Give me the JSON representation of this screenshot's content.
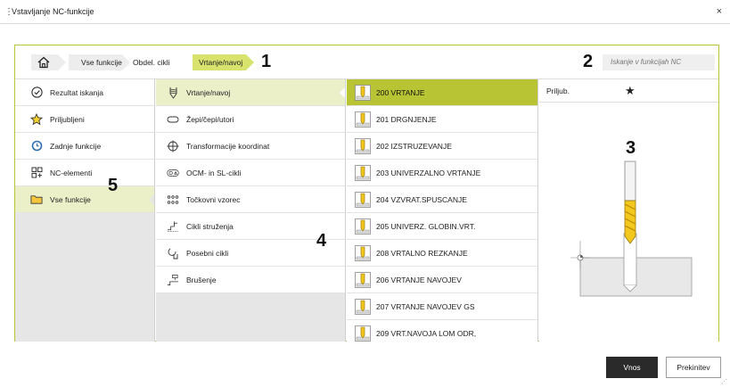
{
  "window": {
    "title": "Vstavljanje NC-funkcije",
    "close_icon": "×",
    "menu_icon": "⋮"
  },
  "breadcrumb": {
    "items": [
      "Vse funkcije",
      "Obdel. cikli",
      "Vrtanje/navoj"
    ],
    "active_index": 2
  },
  "search": {
    "placeholder": "Iskanje v funkcijah NC",
    "value": ""
  },
  "callouts": [
    "1",
    "2",
    "3",
    "4",
    "5"
  ],
  "column1": {
    "items": [
      {
        "label": "Rezultat iskanja",
        "icon": "check-circle-icon"
      },
      {
        "label": "Priljubljeni",
        "icon": "star-outline-icon"
      },
      {
        "label": "Zadnje funkcije",
        "icon": "clock-icon"
      },
      {
        "label": "NC-elementi",
        "icon": "nc-elements-icon"
      },
      {
        "label": "Vse funkcije",
        "icon": "folder-icon"
      }
    ],
    "selected_index": 4
  },
  "column2": {
    "items": [
      {
        "label": "Vrtanje/navoj",
        "icon": "drill-thread-icon"
      },
      {
        "label": "Žepi/čepi/utori",
        "icon": "pocket-slot-icon"
      },
      {
        "label": "Transformacije koordinat",
        "icon": "coordinate-transform-icon"
      },
      {
        "label": "OCM- in SL-cikli",
        "icon": "ocm-sl-icon"
      },
      {
        "label": "Točkovni vzorec",
        "icon": "point-pattern-icon"
      },
      {
        "label": "Cikli struženja",
        "icon": "turning-cycle-icon"
      },
      {
        "label": "Posebni cikli",
        "icon": "special-cycle-icon"
      },
      {
        "label": "Brušenje",
        "icon": "grinding-icon"
      }
    ],
    "selected_index": 0
  },
  "column3": {
    "items": [
      {
        "label": "200 VRTANJE",
        "icon": "cycle-200-icon"
      },
      {
        "label": "201 DRGNJENJE",
        "icon": "cycle-201-icon"
      },
      {
        "label": "202 IZSTRUZEVANJE",
        "icon": "cycle-202-icon"
      },
      {
        "label": "203 UNIVERZALNO VRTANJE",
        "icon": "cycle-203-icon"
      },
      {
        "label": "204 VZVRAT.SPUSCANJE",
        "icon": "cycle-204-icon"
      },
      {
        "label": "205 UNIVERZ. GLOBIN.VRT.",
        "icon": "cycle-205-icon"
      },
      {
        "label": "208 VRTALNO REZKANJE",
        "icon": "cycle-208-icon"
      },
      {
        "label": "206 VRTANJE NAVOJEV",
        "icon": "cycle-206-icon"
      },
      {
        "label": "207 VRTANJE NAVOJEV GS",
        "icon": "cycle-207-icon"
      },
      {
        "label": "209 VRT.NAVOJA LOM ODR,",
        "icon": "cycle-209-icon"
      }
    ],
    "selected_index": 0
  },
  "detail": {
    "favorite_label": "Priljub.",
    "favorite_icon": "star-filled-icon"
  },
  "footer": {
    "ok_label": "Vnos",
    "cancel_label": "Prekinitev"
  },
  "colors": {
    "accent": "#b9c434",
    "accent_light": "#d8e36e",
    "drill_yellow": "#f2c81e"
  }
}
